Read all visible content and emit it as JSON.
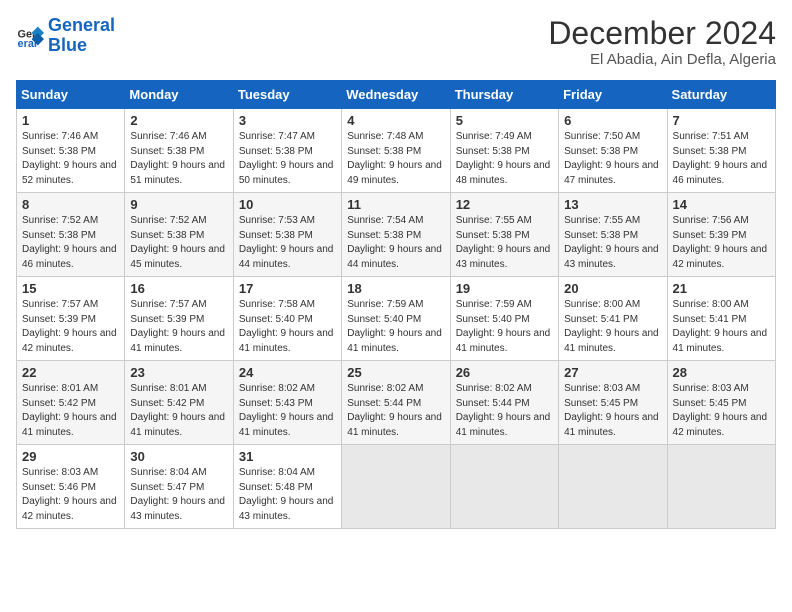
{
  "logo": {
    "line1": "General",
    "line2": "Blue"
  },
  "title": "December 2024",
  "subtitle": "El Abadia, Ain Defla, Algeria",
  "weekdays": [
    "Sunday",
    "Monday",
    "Tuesday",
    "Wednesday",
    "Thursday",
    "Friday",
    "Saturday"
  ],
  "weeks": [
    [
      {
        "day": "1",
        "sunrise": "7:46 AM",
        "sunset": "5:38 PM",
        "daylight": "9 hours and 52 minutes."
      },
      {
        "day": "2",
        "sunrise": "7:46 AM",
        "sunset": "5:38 PM",
        "daylight": "9 hours and 51 minutes."
      },
      {
        "day": "3",
        "sunrise": "7:47 AM",
        "sunset": "5:38 PM",
        "daylight": "9 hours and 50 minutes."
      },
      {
        "day": "4",
        "sunrise": "7:48 AM",
        "sunset": "5:38 PM",
        "daylight": "9 hours and 49 minutes."
      },
      {
        "day": "5",
        "sunrise": "7:49 AM",
        "sunset": "5:38 PM",
        "daylight": "9 hours and 48 minutes."
      },
      {
        "day": "6",
        "sunrise": "7:50 AM",
        "sunset": "5:38 PM",
        "daylight": "9 hours and 47 minutes."
      },
      {
        "day": "7",
        "sunrise": "7:51 AM",
        "sunset": "5:38 PM",
        "daylight": "9 hours and 46 minutes."
      }
    ],
    [
      {
        "day": "8",
        "sunrise": "7:52 AM",
        "sunset": "5:38 PM",
        "daylight": "9 hours and 46 minutes."
      },
      {
        "day": "9",
        "sunrise": "7:52 AM",
        "sunset": "5:38 PM",
        "daylight": "9 hours and 45 minutes."
      },
      {
        "day": "10",
        "sunrise": "7:53 AM",
        "sunset": "5:38 PM",
        "daylight": "9 hours and 44 minutes."
      },
      {
        "day": "11",
        "sunrise": "7:54 AM",
        "sunset": "5:38 PM",
        "daylight": "9 hours and 44 minutes."
      },
      {
        "day": "12",
        "sunrise": "7:55 AM",
        "sunset": "5:38 PM",
        "daylight": "9 hours and 43 minutes."
      },
      {
        "day": "13",
        "sunrise": "7:55 AM",
        "sunset": "5:38 PM",
        "daylight": "9 hours and 43 minutes."
      },
      {
        "day": "14",
        "sunrise": "7:56 AM",
        "sunset": "5:39 PM",
        "daylight": "9 hours and 42 minutes."
      }
    ],
    [
      {
        "day": "15",
        "sunrise": "7:57 AM",
        "sunset": "5:39 PM",
        "daylight": "9 hours and 42 minutes."
      },
      {
        "day": "16",
        "sunrise": "7:57 AM",
        "sunset": "5:39 PM",
        "daylight": "9 hours and 41 minutes."
      },
      {
        "day": "17",
        "sunrise": "7:58 AM",
        "sunset": "5:40 PM",
        "daylight": "9 hours and 41 minutes."
      },
      {
        "day": "18",
        "sunrise": "7:59 AM",
        "sunset": "5:40 PM",
        "daylight": "9 hours and 41 minutes."
      },
      {
        "day": "19",
        "sunrise": "7:59 AM",
        "sunset": "5:40 PM",
        "daylight": "9 hours and 41 minutes."
      },
      {
        "day": "20",
        "sunrise": "8:00 AM",
        "sunset": "5:41 PM",
        "daylight": "9 hours and 41 minutes."
      },
      {
        "day": "21",
        "sunrise": "8:00 AM",
        "sunset": "5:41 PM",
        "daylight": "9 hours and 41 minutes."
      }
    ],
    [
      {
        "day": "22",
        "sunrise": "8:01 AM",
        "sunset": "5:42 PM",
        "daylight": "9 hours and 41 minutes."
      },
      {
        "day": "23",
        "sunrise": "8:01 AM",
        "sunset": "5:42 PM",
        "daylight": "9 hours and 41 minutes."
      },
      {
        "day": "24",
        "sunrise": "8:02 AM",
        "sunset": "5:43 PM",
        "daylight": "9 hours and 41 minutes."
      },
      {
        "day": "25",
        "sunrise": "8:02 AM",
        "sunset": "5:44 PM",
        "daylight": "9 hours and 41 minutes."
      },
      {
        "day": "26",
        "sunrise": "8:02 AM",
        "sunset": "5:44 PM",
        "daylight": "9 hours and 41 minutes."
      },
      {
        "day": "27",
        "sunrise": "8:03 AM",
        "sunset": "5:45 PM",
        "daylight": "9 hours and 41 minutes."
      },
      {
        "day": "28",
        "sunrise": "8:03 AM",
        "sunset": "5:45 PM",
        "daylight": "9 hours and 42 minutes."
      }
    ],
    [
      {
        "day": "29",
        "sunrise": "8:03 AM",
        "sunset": "5:46 PM",
        "daylight": "9 hours and 42 minutes."
      },
      {
        "day": "30",
        "sunrise": "8:04 AM",
        "sunset": "5:47 PM",
        "daylight": "9 hours and 43 minutes."
      },
      {
        "day": "31",
        "sunrise": "8:04 AM",
        "sunset": "5:48 PM",
        "daylight": "9 hours and 43 minutes."
      },
      null,
      null,
      null,
      null
    ]
  ]
}
